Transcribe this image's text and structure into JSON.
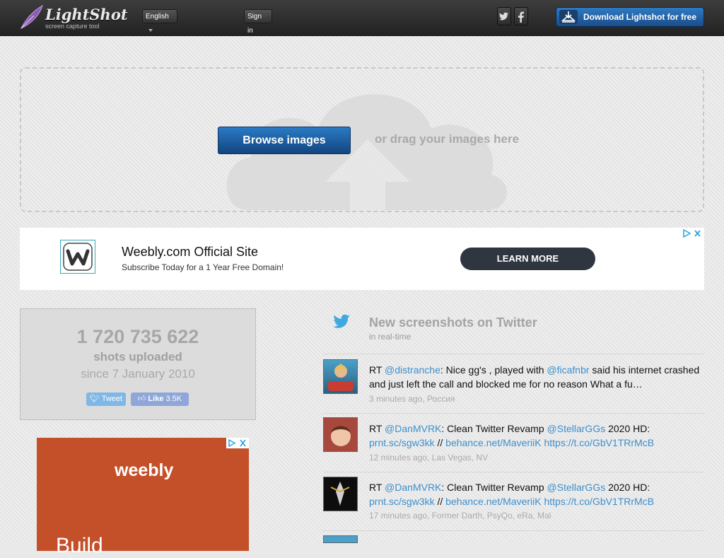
{
  "header": {
    "logo_text": "LightShot",
    "logo_sub": "screen capture tool",
    "language": "English",
    "signin": "Sign in",
    "download_label": "Download Lightshot for free",
    "social": [
      "twitter-icon",
      "facebook-icon"
    ]
  },
  "upload": {
    "browse_label": "Browse images",
    "drag_text": "or drag your images here"
  },
  "ad": {
    "title": "Weebly.com Official Site",
    "subtitle": "Subscribe Today for a 1 Year Free Domain!",
    "cta": "LEARN MORE"
  },
  "stats": {
    "count": "1 720 735 622",
    "label": "shots uploaded",
    "since": "since 7 January 2010",
    "tweet": "Tweet",
    "like": "Like",
    "like_count": "3.5K"
  },
  "ad2": {
    "brand": "weebly",
    "headline": "Build"
  },
  "twitter": {
    "title": "New screenshots on Twitter",
    "subtitle": "in real-time",
    "tweets": [
      {
        "rt": "RT ",
        "m1": "@distranche",
        "t1": ": Nice gg's , played with ",
        "m2": "@ficafnbr",
        "t2": " said his internet crashed",
        "line2": "and just left the call and blocked me for no reason What a fu…",
        "meta": "3 minutes ago, Россия"
      },
      {
        "rt": "RT ",
        "m1": "@DanMVRK",
        "t1": ": Clean Twitter Revamp ",
        "m2": "@StellarGGs",
        "t2": " 2020 HD:",
        "l2a": "prnt.sc/sgw3kk",
        "l2sep": " // ",
        "l2b": "behance.net/MaveriiK",
        "l2c": " https://t.co/GbV1TRrMcB",
        "meta": "12 minutes ago, Las Vegas, NV"
      },
      {
        "rt": "RT ",
        "m1": "@DanMVRK",
        "t1": ": Clean Twitter Revamp ",
        "m2": "@StellarGGs",
        "t2": " 2020 HD:",
        "l2a": "prnt.sc/sgw3kk",
        "l2sep": " // ",
        "l2b": "behance.net/MaveriiK",
        "l2c": " https://t.co/GbV1TRrMcB",
        "meta": "17 minutes ago, Former Darth, PsyQo, eRa, Mal"
      }
    ]
  }
}
